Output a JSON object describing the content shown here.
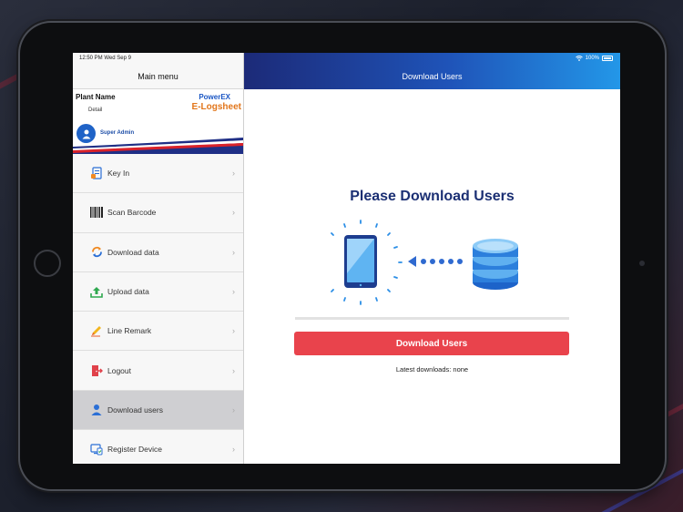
{
  "status": {
    "time_date": "12:50 PM   Wed Sep 9",
    "battery": "100%"
  },
  "sidebar": {
    "title": "Main menu",
    "plant_name": "Plant Name",
    "plant_detail": "Detail",
    "brand_top": "PowerEX",
    "brand_bottom": "E-Logsheet",
    "user_role": "Super Admin",
    "items": [
      {
        "label": "Key In",
        "icon": "key-in-icon"
      },
      {
        "label": "Scan Barcode",
        "icon": "barcode-icon"
      },
      {
        "label": "Download data",
        "icon": "sync-icon"
      },
      {
        "label": "Upload data",
        "icon": "upload-icon"
      },
      {
        "label": "Line Remark",
        "icon": "pencil-icon"
      },
      {
        "label": "Logout",
        "icon": "logout-icon"
      },
      {
        "label": "Download users",
        "icon": "user-icon",
        "active": true
      },
      {
        "label": "Register Device",
        "icon": "register-device-icon"
      }
    ]
  },
  "main": {
    "header_title": "Download Users",
    "heading": "Please Download Users",
    "progress": 0,
    "button_label": "Download Users",
    "latest_downloads": "Latest downloads: none"
  },
  "colors": {
    "accent": "#e9434c",
    "header_start": "#1c2a78",
    "header_end": "#2397e8",
    "title": "#1b2f73"
  }
}
